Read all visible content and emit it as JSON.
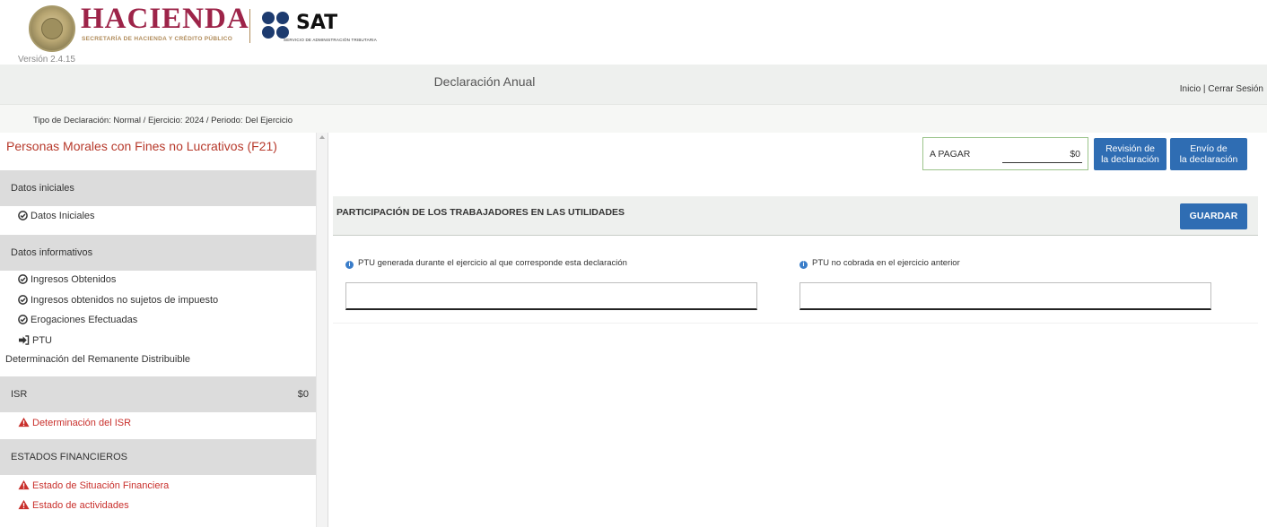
{
  "header": {
    "hacienda_title": "HACIENDA",
    "hacienda_subtitle": "SECRETARÍA DE HACIENDA Y CRÉDITO PÚBLICO",
    "sat_title": "SAT",
    "sat_subtitle": "SERVICIO DE ADMINISTRACIÓN TRIBUTARIA",
    "version": "Versión 2.4.15"
  },
  "title_bar": {
    "title": "Declaración Anual",
    "nav_inicio": "Inicio",
    "nav_separator": " | ",
    "nav_cerrar": "Cerrar Sesión"
  },
  "subtitle": "Tipo de Declaración: Normal / Ejercicio: 2024 / Periodo: Del Ejercicio",
  "sidebar": {
    "form_title": "Personas Morales con Fines no Lucrativos (F21)",
    "sections": [
      {
        "label": "Datos iniciales",
        "amount": ""
      },
      {
        "label": "Datos informativos",
        "amount": ""
      },
      {
        "label": "ISR",
        "amount": "$0"
      },
      {
        "label": "ESTADOS FINANCIEROS",
        "amount": ""
      }
    ],
    "items": {
      "datos_iniciales": "Datos Iniciales",
      "ingresos_obtenidos": "Ingresos Obtenidos",
      "ingresos_no_sujetos": "Ingresos obtenidos no sujetos de impuesto",
      "erogaciones": "Erogaciones Efectuadas",
      "ptu": "PTU",
      "remanente": "Determinación del Remanente Distribuible",
      "determinacion_isr": "Determinación del ISR",
      "situacion_financiera": "Estado de Situación Financiera",
      "estado_actividades": "Estado de actividades"
    }
  },
  "main": {
    "pay_label": "A PAGAR",
    "pay_amount": "$0",
    "btn_revision": [
      "Revisión de",
      "la declaración"
    ],
    "btn_envio": [
      "Envío de",
      "la declaración"
    ],
    "panel_title": "PARTICIPACIÓN DE LOS TRABAJADORES EN LAS UTILIDADES",
    "save_label": "GUARDAR",
    "field1_label": "PTU generada durante el ejercicio al que corresponde esta declaración",
    "field1_value": "",
    "field2_label": "PTU no cobrada en el ejercicio anterior",
    "field2_value": ""
  },
  "colors": {
    "primary_button": "#2f6db3",
    "warning_red": "#c9302c",
    "brand_hacienda": "#9d2449",
    "brand_sat": "#1d3b6f"
  },
  "icons": {
    "complete": "check-circle-icon",
    "current": "sign-in-arrow-icon",
    "warning": "warning-triangle-icon",
    "info": "info-circle-icon"
  }
}
